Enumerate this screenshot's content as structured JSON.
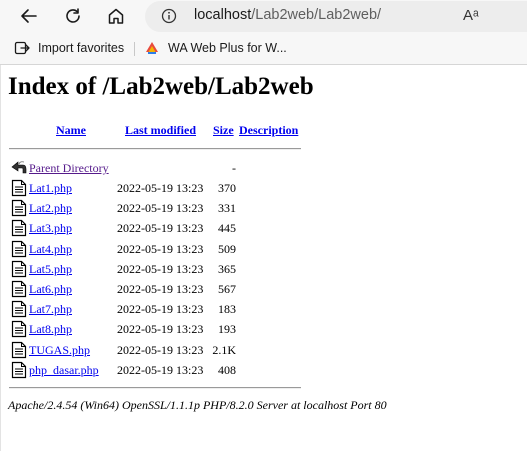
{
  "browser": {
    "url_host": "localhost",
    "url_path": "/Lab2web/Lab2web/",
    "read_aloud_label": "Aᵃ",
    "favorites": [
      {
        "label": "Import favorites",
        "icon": "import-favorites-icon"
      },
      {
        "label": "WA Web Plus for W...",
        "icon": "wa-web-plus-icon"
      }
    ]
  },
  "page": {
    "title": "Index of /Lab2web/Lab2web",
    "columns": {
      "name": "Name",
      "modified": "Last modified",
      "size": "Size",
      "description": "Description"
    },
    "parent": {
      "name": "Parent Directory",
      "size": "-"
    },
    "files": [
      {
        "name": "Lat1.php",
        "modified": "2022-05-19 13:23",
        "size": "370"
      },
      {
        "name": "Lat2.php",
        "modified": "2022-05-19 13:23",
        "size": "331"
      },
      {
        "name": "Lat3.php",
        "modified": "2022-05-19 13:23",
        "size": "445"
      },
      {
        "name": "Lat4.php",
        "modified": "2022-05-19 13:23",
        "size": "509"
      },
      {
        "name": "Lat5.php",
        "modified": "2022-05-19 13:23",
        "size": "365"
      },
      {
        "name": "Lat6.php",
        "modified": "2022-05-19 13:23",
        "size": "567"
      },
      {
        "name": "Lat7.php",
        "modified": "2022-05-19 13:23",
        "size": "183"
      },
      {
        "name": "Lat8.php",
        "modified": "2022-05-19 13:23",
        "size": "193"
      },
      {
        "name": "TUGAS.php",
        "modified": "2022-05-19 13:23",
        "size": "2.1K"
      },
      {
        "name": "php_dasar.php",
        "modified": "2022-05-19 13:23",
        "size": "408"
      }
    ],
    "server_signature": "Apache/2.4.54 (Win64) OpenSSL/1.1.1p PHP/8.2.0 Server at localhost Port 80"
  },
  "colors": {
    "link": "#0000ee",
    "visited_link": "#551a8b"
  }
}
